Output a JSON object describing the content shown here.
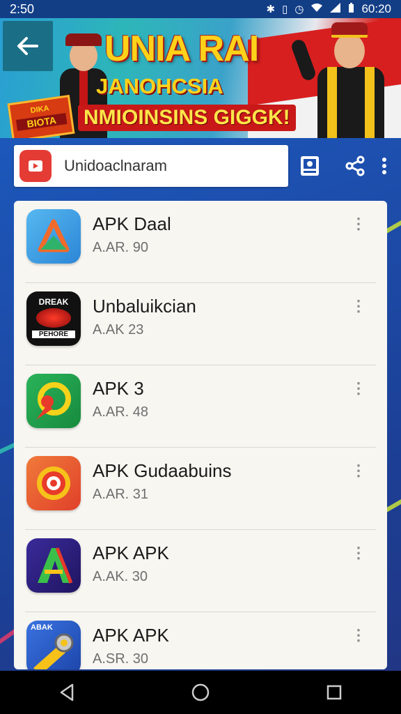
{
  "status_bar": {
    "left_time": "2:50",
    "right_time": "60:20",
    "icons": [
      "nfc-icon",
      "vibrate-icon",
      "alarm-icon",
      "wifi-icon",
      "signal-icon",
      "battery-icon"
    ]
  },
  "banner": {
    "title": "UNIA RAI",
    "subtitle": "JANOHCSIA",
    "slogan": "NMIOINSINS GIGGK!",
    "ticket_text_top": "DIKA",
    "ticket_text_bottom": "BIOTA"
  },
  "search": {
    "value": "Unidoaclnaram",
    "app_icon": "video-play-icon"
  },
  "toolbar": {
    "icons": [
      "image-icon",
      "share-icon",
      "more-vert-icon"
    ]
  },
  "apps": [
    {
      "name": "APK Daal",
      "meta": "A.AR. 90",
      "icon": "triangle-logo-icon",
      "bg": "#3aa0e8"
    },
    {
      "name": "Unbaluikcian",
      "meta": "A.AK 23",
      "icon": "dreak-pehore-logo-icon",
      "bg": "#111111",
      "icon_text_top": "DREAK",
      "icon_text_bottom": "PEHORE"
    },
    {
      "name": "APK 3",
      "meta": "A.AR. 48",
      "icon": "green-swirl-logo-icon",
      "bg": "#1f9e4a"
    },
    {
      "name": "APK Gudaabuins",
      "meta": "A.AR. 31",
      "icon": "orange-gear-logo-icon",
      "bg": "#e8552a"
    },
    {
      "name": "APK APK",
      "meta": "A.AK. 30",
      "icon": "letter-a-logo-icon",
      "bg": "#2b1f7a"
    },
    {
      "name": "APK APK",
      "meta": "A.SR. 30",
      "icon": "tools-logo-icon",
      "bg": "#2a55c8",
      "icon_text_top": "ABAK"
    }
  ],
  "colors": {
    "accent_blue": "#1d4fae",
    "banner_red": "#d81f1f",
    "banner_yellow": "#ffd21a",
    "card_bg": "#f7f6f1"
  },
  "nav": [
    "back-nav-icon",
    "home-nav-icon",
    "recents-nav-icon"
  ]
}
